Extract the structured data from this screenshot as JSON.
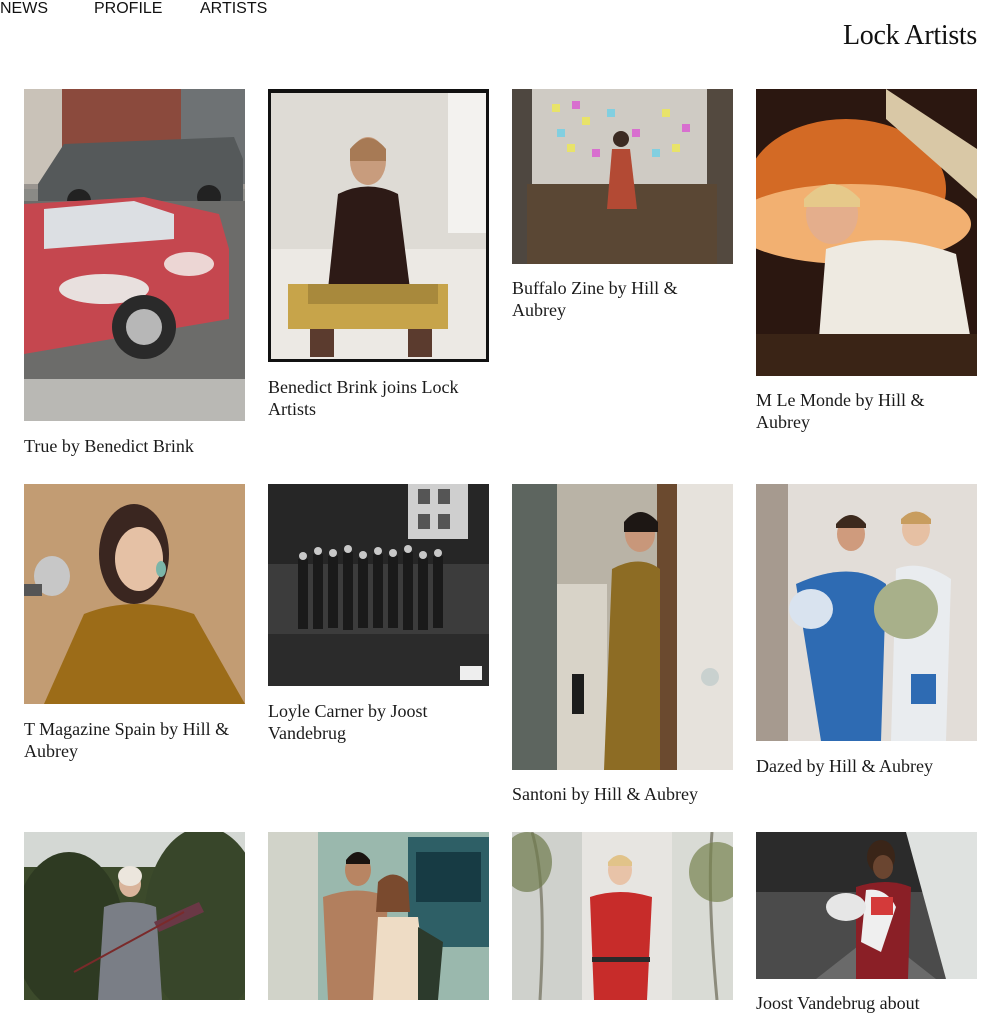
{
  "nav": {
    "items": [
      {
        "label": "NEWS",
        "active": true
      },
      {
        "label": "PROFILE",
        "active": false
      },
      {
        "label": "ARTISTS",
        "active": false
      }
    ]
  },
  "brand": {
    "name": "Lock Artists"
  },
  "tiles": [
    {
      "caption": "True by Benedict Brink",
      "image": "street-car-van-photo"
    },
    {
      "caption": "Benedict Brink joins Lock Artists",
      "image": "portrait-bed-photo"
    },
    {
      "caption": "Buffalo Zine by Hill & Aubrey",
      "image": "sticky-notes-desk-photo"
    },
    {
      "caption": "M Le Monde by Hill & Aubrey",
      "image": "boy-orange-light-photo"
    },
    {
      "caption": "T Magazine Spain by Hill & Aubrey",
      "image": "woman-microphone-photo"
    },
    {
      "caption": "Loyle Carner by Joost Vandebrug",
      "image": "group-garden-bw-photo"
    },
    {
      "caption": "Santoni by Hill & Aubrey",
      "image": "man-doorway-photo"
    },
    {
      "caption": "Dazed by Hill & Aubrey",
      "image": "couple-sculptural-outfits-photo"
    },
    {
      "caption": "",
      "image": "man-hedge-photo"
    },
    {
      "caption": "",
      "image": "couple-tattoo-photo"
    },
    {
      "caption": "",
      "image": "man-red-jumpsuit-photo"
    },
    {
      "caption": "Joost Vandebrug about",
      "image": "man-skateboard-photo"
    }
  ],
  "colors": {
    "text": "#111111",
    "background": "#ffffff"
  }
}
